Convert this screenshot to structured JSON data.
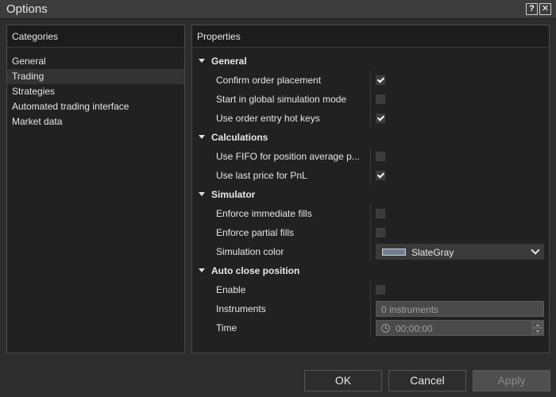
{
  "window": {
    "title": "Options",
    "help_icon": "?",
    "close_icon": "✕"
  },
  "categories": {
    "header": "Categories",
    "items": [
      {
        "label": "General",
        "selected": false
      },
      {
        "label": "Trading",
        "selected": true
      },
      {
        "label": "Strategies",
        "selected": false
      },
      {
        "label": "Automated trading interface",
        "selected": false
      },
      {
        "label": "Market data",
        "selected": false
      }
    ]
  },
  "properties": {
    "header": "Properties",
    "groups": {
      "general": {
        "label": "General",
        "confirm_order_placement": {
          "label": "Confirm order placement",
          "checked": true
        },
        "global_simulation": {
          "label": "Start in global simulation mode",
          "checked": false
        },
        "hot_keys": {
          "label": "Use order entry hot keys",
          "checked": true
        }
      },
      "calculations": {
        "label": "Calculations",
        "fifo": {
          "label": "Use FIFO for position average p...",
          "checked": false
        },
        "last_price_pnl": {
          "label": "Use last price for PnL",
          "checked": true
        }
      },
      "simulator": {
        "label": "Simulator",
        "immediate_fills": {
          "label": "Enforce immediate fills",
          "checked": false
        },
        "partial_fills": {
          "label": "Enforce partial fills",
          "checked": false
        },
        "simulation_color": {
          "label": "Simulation color",
          "value": "SlateGray",
          "swatch": "#708090"
        }
      },
      "auto_close": {
        "label": "Auto close position",
        "enable": {
          "label": "Enable",
          "checked": false
        },
        "instruments": {
          "label": "Instruments",
          "value": "0 instruments"
        },
        "time": {
          "label": "Time",
          "value": "00:00:00"
        }
      }
    }
  },
  "buttons": {
    "ok": "OK",
    "cancel": "Cancel",
    "apply": "Apply"
  }
}
